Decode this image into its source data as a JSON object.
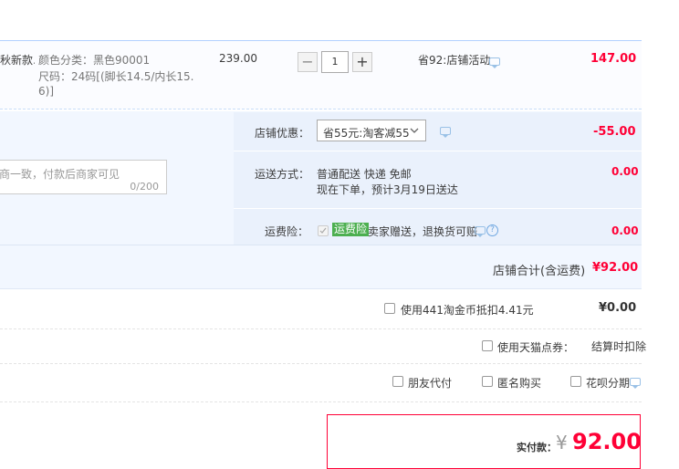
{
  "item": {
    "name_fragment": "秋新款…",
    "sku_color": "颜色分类：黑色90001",
    "sku_size_line1": "尺码：24码[(脚长14.5/内长15.",
    "sku_size_line2": "6)]",
    "unit_price": "239.00",
    "quantity": "1",
    "promo": "省92:店铺活动",
    "subtotal": "147.00",
    "minus": "−",
    "plus": "+"
  },
  "shop": {
    "discount_label": "店铺优惠：",
    "discount_value": "省55元:淘客减55",
    "discount_amount": "-55.00",
    "message_placeholder": "商一致，付款后商家可见",
    "message_count": "0/200",
    "shipping_label": "运送方式：",
    "shipping_line1": "普通配送 快递 免邮",
    "shipping_line2": "现在下单，预计3月19日送达",
    "shipping_amount": "0.00",
    "insurance_label": "运费险：",
    "insurance_badge": "运费险",
    "insurance_text": "卖家赠送，退换货可赔",
    "insurance_amount": "0.00",
    "total_label": "店铺合计(含运费)",
    "total_value": "¥92.00"
  },
  "options": {
    "coins_label": "使用441淘金币抵扣4.41元",
    "coins_amount": "¥0.00",
    "tmall_points_label": "使用天猫点券：",
    "tmall_points_value": "结算时扣除",
    "friend_pay": "朋友代付",
    "anonymous": "匿名购买",
    "huabei": "花呗分期"
  },
  "payment": {
    "label": "实付款：",
    "currency": "¥",
    "amount": "92.00"
  },
  "colors": {
    "accent_red": "#ff0036",
    "shop_bg": "#f2f7ff",
    "border_blue": "#b2d1ff",
    "badge_green": "#4caf50"
  }
}
